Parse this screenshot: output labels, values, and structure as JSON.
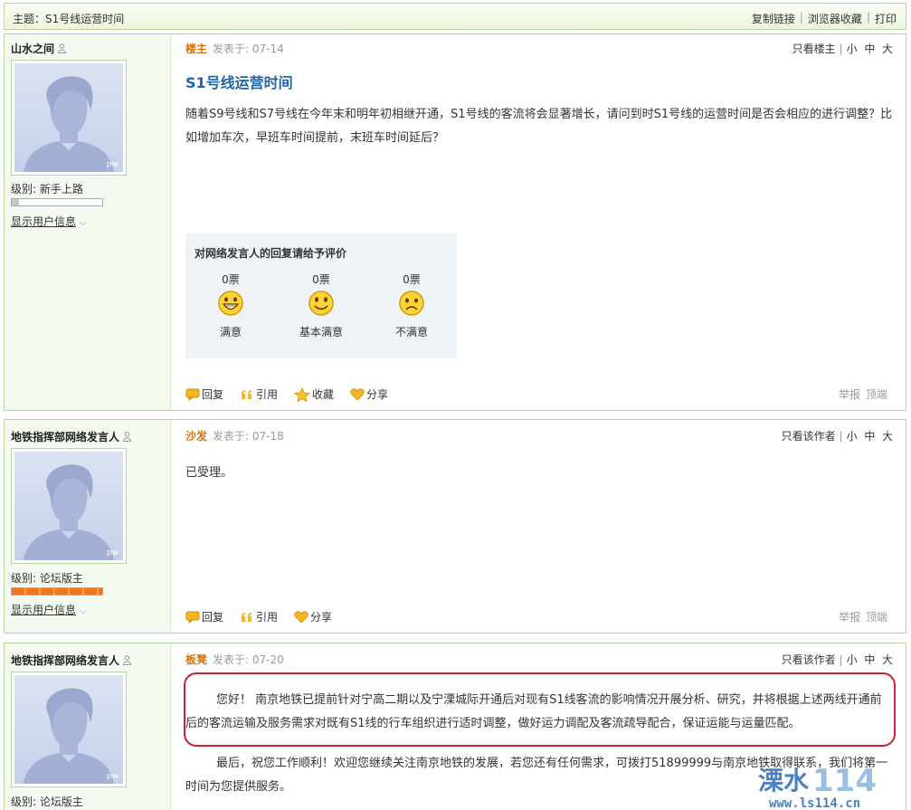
{
  "topbar": {
    "subject": "主题：S1号线运营时间",
    "copy_link": "复制链接",
    "bookmark": "浏览器收藏",
    "print": "打印"
  },
  "posts": [
    {
      "username": "山水之间",
      "level": "级别: 新手上路",
      "level_progress": 0.08,
      "show_info": "显示用户信息",
      "floor": "楼主",
      "posted": "发表于: 07-14",
      "view_filter": "只看楼主",
      "size_small": "小",
      "size_medium": "中",
      "size_large": "大",
      "title": "S1号线运营时间",
      "content": "随着S9号线和S7号线在今年末和明年初相继开通，S1号线的客流将会显著增长，请问到时S1号线的运营时间是否会相应的进行调整？比如增加车次，早班车时间提前，末班车时间延后？",
      "rating": {
        "title": "对网络发言人的回复请给予评价",
        "options": [
          {
            "votes": "0票",
            "label": "满意",
            "icon": "grin-face-icon"
          },
          {
            "votes": "0票",
            "label": "基本满意",
            "icon": "smile-face-icon"
          },
          {
            "votes": "0票",
            "label": "不满意",
            "icon": "sad-face-icon"
          }
        ]
      },
      "actions": {
        "reply": "回复",
        "quote": "引用",
        "favorite": "收藏",
        "share": "分享"
      },
      "report": "举报",
      "top": "顶端"
    },
    {
      "username": "地铁指挥部网络发言人",
      "level": "级别: 论坛版主",
      "level_progress": 1.0,
      "show_info": "显示用户信息",
      "floor": "沙发",
      "posted": "发表于: 07-18",
      "view_filter": "只看该作者",
      "size_small": "小",
      "size_medium": "中",
      "size_large": "大",
      "content": "已受理。",
      "actions": {
        "reply": "回复",
        "quote": "引用",
        "share": "分享"
      },
      "report": "举报",
      "top": "顶端"
    },
    {
      "username": "地铁指挥部网络发言人",
      "level": "级别: 论坛版主",
      "floor": "板凳",
      "posted": "发表于: 07-20",
      "view_filter": "只看该作者",
      "size_small": "小",
      "size_medium": "中",
      "size_large": "大",
      "para1": "您好！ 南京地铁已提前针对宁高二期以及宁溧城际开通后对现有S1线客流的影响情况开展分析、研究，并将根据上述两线开通前后的客流运输及服务需求对既有S1线的行车组织进行适时调整，做好运力调配及客流疏导配合，保证运能与运量匹配。",
      "para2": "最后，祝您工作顺利！欢迎您继续关注南京地铁的发展，若您还有任何需求，可拨打51899999与南京地铁取得联系，我们将第一时间为您提供服务。"
    }
  ],
  "watermark": {
    "brand": "溧水114",
    "url": "www.ls114.cn"
  }
}
